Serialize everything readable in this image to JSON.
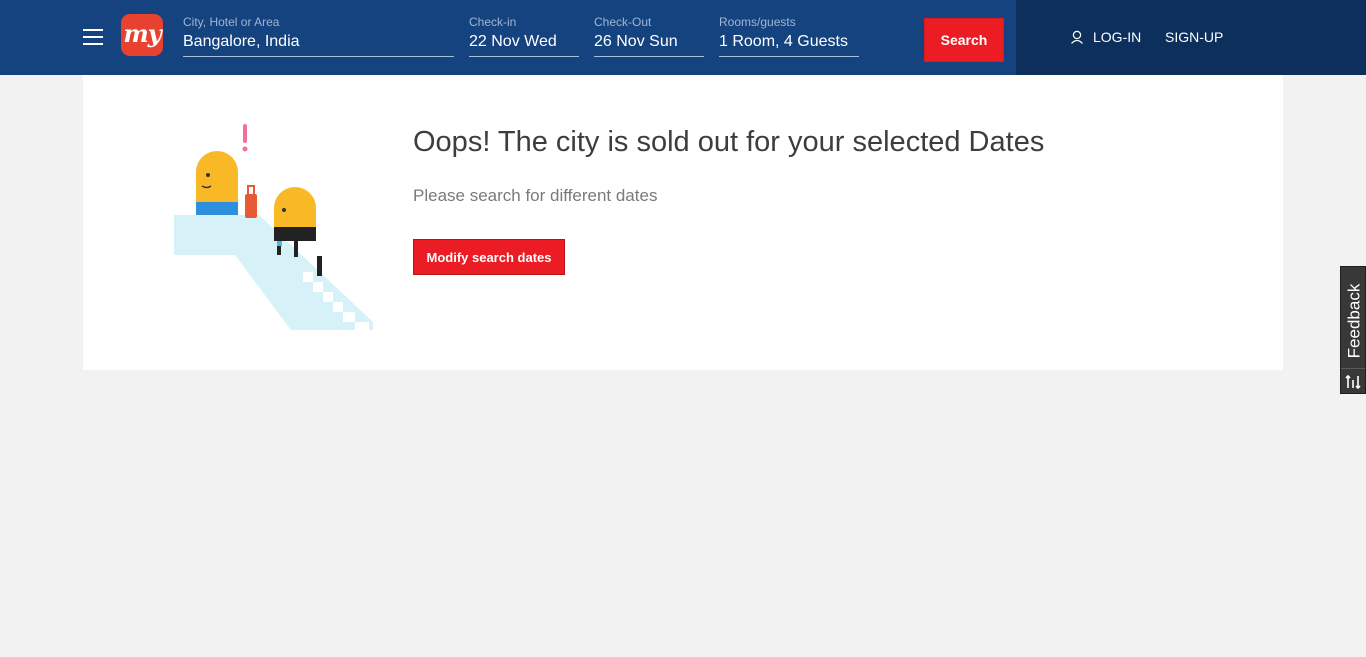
{
  "header": {
    "logo_text": "my",
    "search_fields": {
      "city": {
        "label": "City, Hotel or Area",
        "value": "Bangalore, India"
      },
      "checkin": {
        "label": "Check-in",
        "value": "22 Nov Wed"
      },
      "checkout": {
        "label": "Check-Out",
        "value": "26 Nov Sun"
      },
      "rooms": {
        "label": "Rooms/guests",
        "value": "1 Room, 4 Guests"
      }
    },
    "search_button": "Search",
    "login": "LOG-IN",
    "signup": "SIGN-UP",
    "colors": {
      "bar": "#15437f",
      "bar_right": "#0d2f5c",
      "accent": "#ec1c24"
    }
  },
  "message": {
    "heading": "Oops! The city is sold out for your selected Dates",
    "subheading": "Please search for different dates",
    "button": "Modify search dates"
  },
  "feedback": {
    "label": "Feedback"
  }
}
